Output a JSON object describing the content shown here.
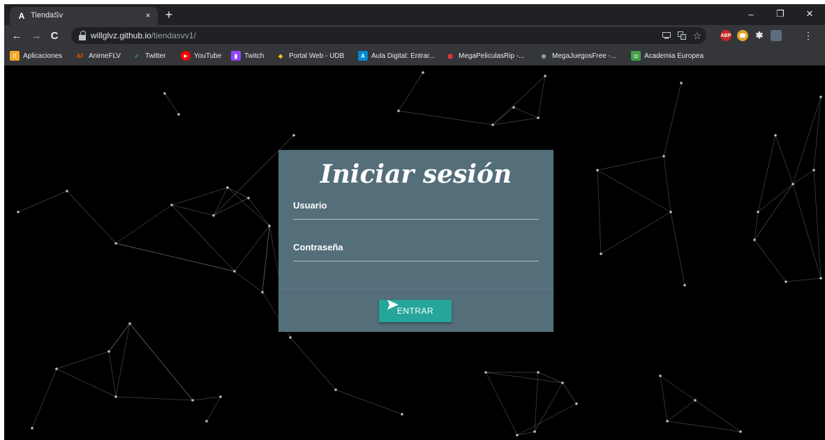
{
  "browser": {
    "tab": {
      "favicon": "A",
      "title": "TiendaSv",
      "close": "×"
    },
    "new_tab": "+",
    "window_controls": {
      "minimize": "–",
      "restore": "❐",
      "close": "✕"
    },
    "nav": {
      "back": "←",
      "forward": "→",
      "reload": "C"
    },
    "address": {
      "host": "willglvz.github.io",
      "path": "/tiendasvv1/"
    },
    "toolbar_icons": [
      "cast-icon",
      "translate-icon",
      "star-icon"
    ],
    "extensions": [
      {
        "name": "adblock-plus-icon",
        "label": "ABP",
        "color": "#c62828"
      },
      {
        "name": "extension-icon",
        "label": "",
        "color": "#e0a82e"
      },
      {
        "name": "puzzle-icon",
        "label": "",
        "color": "#35363a"
      },
      {
        "name": "profile-avatar-icon",
        "label": "",
        "color": "#5d6d7e"
      }
    ],
    "menu": "⋮"
  },
  "bookmarks": [
    {
      "label": "Aplicaciones",
      "icon": "apps-grid-icon",
      "color": "#f9a825",
      "glyph": "⁞⁞"
    },
    {
      "label": "AnimeFLV",
      "icon": "animeflv-icon",
      "color": "#e65100",
      "glyph": "AF"
    },
    {
      "label": "Twitter",
      "icon": "twitter-icon",
      "color": "#1da1f2",
      "glyph": "✓"
    },
    {
      "label": "YouTube",
      "icon": "youtube-icon",
      "color": "#ff0000",
      "glyph": "▶"
    },
    {
      "label": "Twitch",
      "icon": "twitch-icon",
      "color": "#9146ff",
      "glyph": "▮"
    },
    {
      "label": "Portal Web - UDB",
      "icon": "udb-icon",
      "color": "#f4c20d",
      "glyph": "◆"
    },
    {
      "label": "Aula Digital: Entrar...",
      "icon": "aula-digital-icon",
      "color": "#0288d1",
      "glyph": "A"
    },
    {
      "label": "MegaPeliculasRip -...",
      "icon": "megapeliculas-icon",
      "color": "#c62828",
      "glyph": "▦"
    },
    {
      "label": "MegaJuegosFree -...",
      "icon": "megajuegos-icon",
      "color": "#455a64",
      "glyph": "◉"
    },
    {
      "label": "Academia Europea",
      "icon": "academia-icon",
      "color": "#43a047",
      "glyph": "◘"
    }
  ],
  "login": {
    "title": "Iniciar sesión",
    "username_label": "Usuario",
    "password_label": "Contraseña",
    "submit_label": "ENTRAR",
    "submit_icon": "send-icon"
  },
  "colors": {
    "card": "#546e7a",
    "button": "#26a69a",
    "background": "#000000",
    "network_lines": "#9e9e9e"
  }
}
